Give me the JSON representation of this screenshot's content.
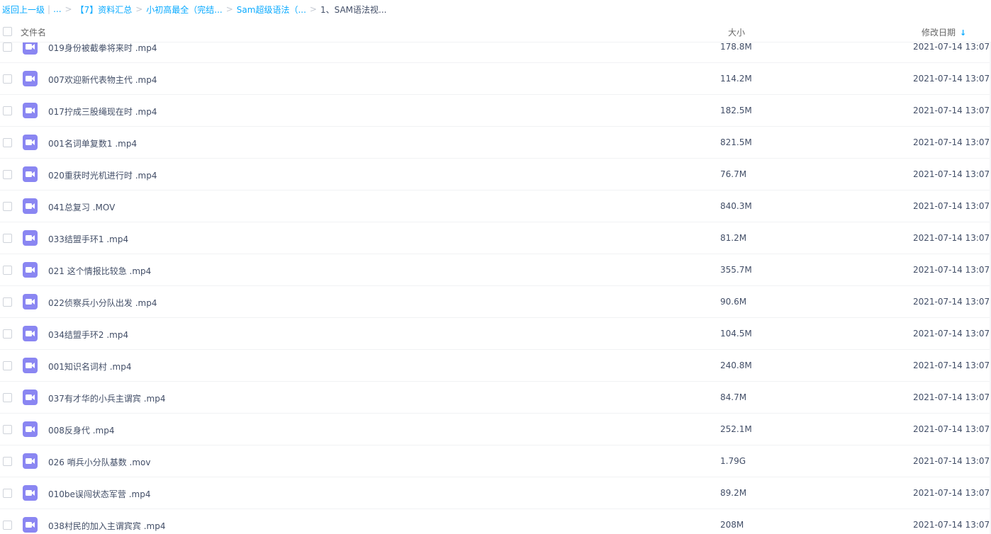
{
  "breadcrumb": {
    "back": "返回上一级",
    "ellipsis": "...",
    "items": [
      "【7】资料汇总",
      "小初高最全（完结...",
      "Sam超级语法（..."
    ],
    "current": "1、SAM语法视..."
  },
  "header": {
    "name": "文件名",
    "size": "大小",
    "date": "修改日期",
    "sort_icon": "arrow-down-icon"
  },
  "colors": {
    "link": "#09aaff",
    "video_icon": "#8a86f2",
    "text": "#424e67"
  },
  "files": [
    {
      "name": "019身份被截拳将来时 .mp4",
      "size": "178.8M",
      "date": "2021-07-14 13:07",
      "icon": "video-file-icon"
    },
    {
      "name": "007欢迎新代表物主代 .mp4",
      "size": "114.2M",
      "date": "2021-07-14 13:07",
      "icon": "video-file-icon"
    },
    {
      "name": "017拧成三股绳现在时 .mp4",
      "size": "182.5M",
      "date": "2021-07-14 13:07",
      "icon": "video-file-icon"
    },
    {
      "name": "001名词单复数1 .mp4",
      "size": "821.5M",
      "date": "2021-07-14 13:07",
      "icon": "video-file-icon"
    },
    {
      "name": "020重获时光机进行时 .mp4",
      "size": "76.7M",
      "date": "2021-07-14 13:07",
      "icon": "video-file-icon"
    },
    {
      "name": "041总复习 .MOV",
      "size": "840.3M",
      "date": "2021-07-14 13:07",
      "icon": "video-file-icon"
    },
    {
      "name": "033结盟手环1 .mp4",
      "size": "81.2M",
      "date": "2021-07-14 13:07",
      "icon": "video-file-icon"
    },
    {
      "name": "021 这个情报比较急 .mp4",
      "size": "355.7M",
      "date": "2021-07-14 13:07",
      "icon": "video-file-icon"
    },
    {
      "name": "022侦察兵小分队出发 .mp4",
      "size": "90.6M",
      "date": "2021-07-14 13:07",
      "icon": "video-file-icon"
    },
    {
      "name": "034结盟手环2 .mp4",
      "size": "104.5M",
      "date": "2021-07-14 13:07",
      "icon": "video-file-icon"
    },
    {
      "name": "001知识名词村 .mp4",
      "size": "240.8M",
      "date": "2021-07-14 13:07",
      "icon": "video-file-icon"
    },
    {
      "name": "037有才华的小兵主谓宾 .mp4",
      "size": "84.7M",
      "date": "2021-07-14 13:07",
      "icon": "video-file-icon"
    },
    {
      "name": "008反身代 .mp4",
      "size": "252.1M",
      "date": "2021-07-14 13:07",
      "icon": "video-file-icon"
    },
    {
      "name": "026 哨兵小分队基数 .mov",
      "size": "1.79G",
      "date": "2021-07-14 13:07",
      "icon": "video-file-icon"
    },
    {
      "name": "010be误闯状态军营 .mp4",
      "size": "89.2M",
      "date": "2021-07-14 13:07",
      "icon": "video-file-icon"
    },
    {
      "name": "038村民的加入主谓宾宾 .mp4",
      "size": "208M",
      "date": "2021-07-14 13:07",
      "icon": "video-file-icon"
    }
  ]
}
